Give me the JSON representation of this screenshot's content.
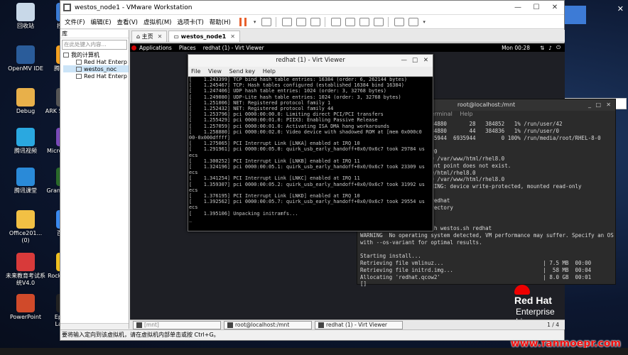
{
  "desktop": {
    "icons": [
      {
        "label": "回收站",
        "color": "#c8d8e8"
      },
      {
        "label": "控制面",
        "color": "#3a7bd5"
      },
      {
        "label": "OpenMV IDE",
        "color": "#2a5c9a"
      },
      {
        "label": "腾讯影视",
        "color": "#f4a020"
      },
      {
        "label": "Debug",
        "color": "#e8b04a"
      },
      {
        "label": "ARK Sur Evolv",
        "color": "#555555"
      },
      {
        "label": "腾讯视频",
        "color": "#2aa8e0"
      },
      {
        "label": "Micros Visual",
        "color": "#7a4ab8"
      },
      {
        "label": "腾讯课堂",
        "color": "#2a8ad8"
      },
      {
        "label": "Grand T Auto",
        "color": "#2a6a2a"
      },
      {
        "label": "Office201... (0)",
        "color": "#f2c044"
      },
      {
        "label": "百度网",
        "color": "#3a8af0"
      },
      {
        "label": "未来教育考试系统V4.0",
        "color": "#d83a3a"
      },
      {
        "label": "Rocks Game",
        "color": "#f0c020"
      },
      {
        "label": "PowerPoint",
        "color": "#d04a2a"
      },
      {
        "label": "Epic Ga Launch",
        "color": "#222222"
      }
    ],
    "watermark": "www.fanmoepr.com",
    "ime_label": "中"
  },
  "vmware": {
    "title": "westos_node1 - VMware Workstation",
    "menus": [
      "文件(F)",
      "编辑(E)",
      "查看(V)",
      "虚拟机(M)",
      "选项卡(T)",
      "帮助(H)"
    ],
    "library": {
      "heading": "库",
      "search_placeholder": "在此处键入内容...",
      "root": "我的计算机",
      "items": [
        "Red Hat Enterp",
        "westos_noc",
        "Red Hat Enterp"
      ]
    },
    "tabs": [
      {
        "label": "主页"
      },
      {
        "label": "westos_node1"
      }
    ],
    "status": "要将输入定向到该虚拟机，请在虚拟机内部单击或按 Ctrl+G。"
  },
  "guest": {
    "topbar": {
      "applications": "Applications",
      "places": "Places",
      "window": "redhat (1) - Virt Viewer",
      "time": "Mon 00:28"
    },
    "brand": {
      "line1": "Red Hat",
      "line2": "Enterprise Linux"
    },
    "taskbar": {
      "items": [
        "[mnt]",
        "root@localhost:/mnt",
        "redhat (1) - Virt Viewer"
      ],
      "pager": "1 / 4"
    }
  },
  "terminal": {
    "title": "root@localhost:/mnt",
    "menu": [
      "Terminal",
      "Help"
    ],
    "lines": [
      "                     384880       28   384852   1% /run/user/42",
      "                     384880       44   384836   1% /run/user/0",
      "                    6935944  6935944        0 100% /run/media/root/RHEL-8-0",
      "",
      "            unt /dev/sr0",
      "            nt /dev/sr0 /var/www/html/rhel8.0",
      "            hel8.0: mount point does not exist.",
      "            ir /var/www/html/rhel8.0",
      "            nt /dev/sr0 /var/www/html/rhel8.0",
      "            el8.0: WARNING: device write-protected, mounted read-only",
      "",
      "            westos.sh redhat",
      "            file or directory",
      "            westos.sh",
      "            /mnt",
      "[root@localhost mnt]# sh westos.sh redhat",
      "WARNING  No operating system detected, VM performance may suffer. Specify an OS",
      "with --os-variant for optimal results.",
      "",
      "Starting install...",
      "Retrieving file vmlinuz...                               | 7.5 MB  00:00",
      "Retrieving file initrd.img...                            |  58 MB  00:04",
      "Allocating 'redhat.qcow2'                                | 8.0 GB  00:01",
      "[]"
    ]
  },
  "virt_viewer": {
    "title": "redhat (1) - Virt Viewer",
    "menu": [
      "File",
      "View",
      "Send key",
      "Help"
    ],
    "console": [
      "[    1.243399] TCP bind hash table entries: 16384 (order: 6, 262144 bytes)",
      "[    1.245467] TCP: Hash tables configured (established 16384 bind 16384)",
      "[    1.247406] UDP hash table entries: 1024 (order: 3, 32768 bytes)",
      "[    1.249080] UDP-Lite hash table entries: 1024 (order: 3, 32768 bytes)",
      "[    1.251006] NET: Registered protocol family 1",
      "[    1.252432] NET: Registered protocol family 44",
      "[    1.253796] pci 0000:00:00.0: Limiting direct PCI/PCI transfers",
      "[    1.255429] pci 0000:00:01.0: PIIX3: Enabling Passive Release",
      "[    1.257059] pci 0000:00:01.0: Activating ISA DMA hang workarounds",
      "[    1.258880] pci 0000:00:02.0: Video device with shadowed ROM at [mem 0x000c0",
      "00-0x000dffff]",
      "[    1.275065] PCI Interrupt Link [LNKA] enabled at IRQ 10",
      "[    1.291961] pci 0000:00:05.0: quirk_usb_early_handoff+0x0/0x6c7 took 29784 us",
      "ecs",
      "[    1.300252] PCI Interrupt Link [LNKB] enabled at IRQ 11",
      "[    1.324196] pci 0000:00:05.1: quirk_usb_early_handoff+0x0/0x6c7 took 23309 us",
      "ecs",
      "[    1.341254] PCI Interrupt Link [LNKC] enabled at IRQ 11",
      "[    1.359307] pci 0000:00:05.2: quirk_usb_early_handoff+0x0/0x6c7 took 31992 us",
      "ecs",
      "[    1.376195] PCI Interrupt Link [LNKD] enabled at IRQ 10",
      "[    1.392562] pci 0000:00:05.7: quirk_usb_early_handoff+0x0/0x6c7 took 29554 us",
      "ecs",
      "[    1.395106] Unpacking initramfs...",
      "_"
    ]
  }
}
